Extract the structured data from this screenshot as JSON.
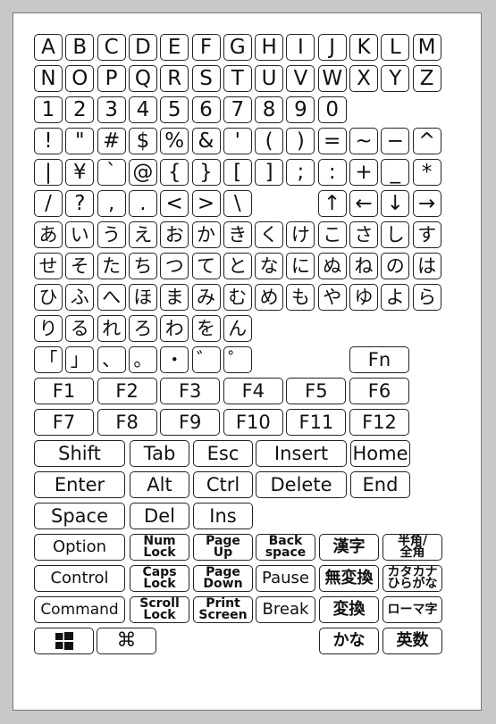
{
  "rows": [
    [
      "A",
      "B",
      "C",
      "D",
      "E",
      "F",
      "G",
      "H",
      "I",
      "J",
      "K",
      "L",
      "M"
    ],
    [
      "N",
      "O",
      "P",
      "Q",
      "R",
      "S",
      "T",
      "U",
      "V",
      "W",
      "X",
      "Y",
      "Z"
    ],
    [
      "1",
      "2",
      "3",
      "4",
      "5",
      "6",
      "7",
      "8",
      "9",
      "0"
    ],
    [
      "!",
      "\"",
      "#",
      "$",
      "%",
      "&",
      "'",
      "(",
      ")",
      "=",
      "~",
      "−",
      "^"
    ],
    [
      "|",
      "¥",
      "`",
      "@",
      "{",
      "}",
      "[",
      "]",
      ";",
      ":",
      "+",
      "_",
      "*"
    ],
    [
      "/",
      "?",
      ",",
      ".",
      "<",
      ">",
      "\\",
      "↑",
      "←",
      "↓",
      "→"
    ],
    [
      "あ",
      "い",
      "う",
      "え",
      "お",
      "か",
      "き",
      "く",
      "け",
      "こ",
      "さ",
      "し",
      "す"
    ],
    [
      "せ",
      "そ",
      "た",
      "ち",
      "つ",
      "て",
      "と",
      "な",
      "に",
      "ぬ",
      "ね",
      "の",
      "は"
    ],
    [
      "ひ",
      "ふ",
      "へ",
      "ほ",
      "ま",
      "み",
      "む",
      "め",
      "も",
      "や",
      "ゆ",
      "よ",
      "ら"
    ],
    [
      "り",
      "る",
      "れ",
      "ろ",
      "わ",
      "を",
      "ん"
    ],
    [
      "「",
      "」",
      "、",
      "。",
      "・",
      "゛",
      "゜",
      "Fn"
    ]
  ],
  "fkeys1": [
    "F1",
    "F2",
    "F3",
    "F4",
    "F5",
    "F6"
  ],
  "fkeys2": [
    "F7",
    "F8",
    "F9",
    "F10",
    "F11",
    "F12"
  ],
  "mod1": [
    "Shift",
    "Tab",
    "Esc",
    "Insert",
    "Home"
  ],
  "mod2": [
    "Enter",
    "Alt",
    "Ctrl",
    "Delete",
    "End"
  ],
  "mod3": [
    "Space",
    "Del",
    "Ins"
  ],
  "row_option": [
    "Option",
    "Num\nLock",
    "Page\nUp",
    "Back\nspace",
    "漢字",
    "半角/\n全角"
  ],
  "row_control": [
    "Control",
    "Caps\nLock",
    "Page\nDown",
    "Pause",
    "無変換",
    "カタカナ\nひらがな"
  ],
  "row_command": [
    "Command",
    "Scroll\nLock",
    "Print\nScreen",
    "Break",
    "変換",
    "ローマ字"
  ],
  "row_last": [
    "windows-icon",
    "⌘",
    "かな",
    "英数"
  ]
}
